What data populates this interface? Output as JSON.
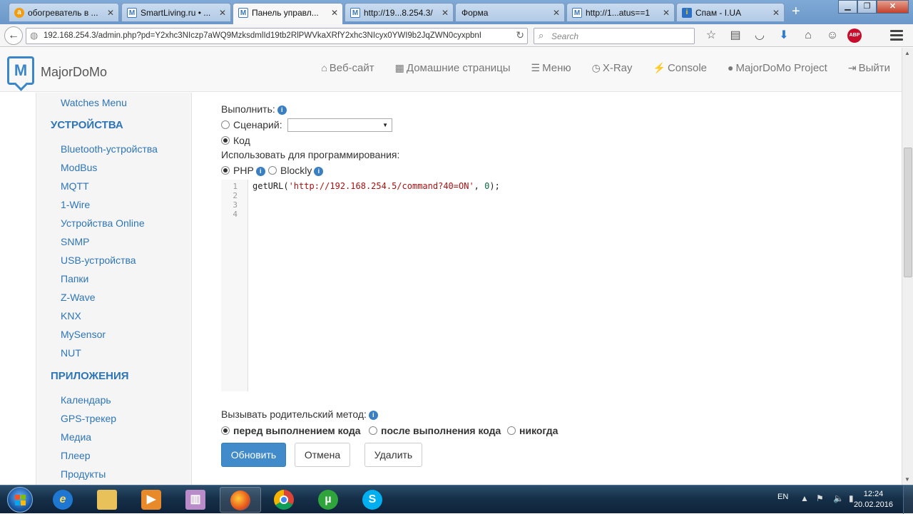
{
  "tabs": [
    {
      "label": "обогреватель в ...",
      "icon": "amazon-favicon"
    },
    {
      "label": "SmartLiving.ru • ...",
      "icon": "majordomo-favicon"
    },
    {
      "label": "Панель управл...",
      "icon": "majordomo-favicon"
    },
    {
      "label": "http://19...8.254.3/",
      "icon": "majordomo-favicon"
    },
    {
      "label": "Форма",
      "icon": ""
    },
    {
      "label": "http://1...atus==1",
      "icon": "majordomo-favicon"
    },
    {
      "label": "Спам - I.UA",
      "icon": "iua-favicon"
    }
  ],
  "url": "192.168.254.3/admin.php?pd=Y2xhc3NIczp7aWQ9MzksdmlId19tb2RlPWVkaXRfY2xhc3NIcyx0YWI9b2JqZWN0cyxpbnI",
  "search_placeholder": "Search",
  "brand": "MajorDoMo",
  "logo_letter": "M",
  "topnav": [
    {
      "label": "Веб-сайт",
      "icon": "⌂"
    },
    {
      "label": "Домашние страницы",
      "icon": "▦"
    },
    {
      "label": "Меню",
      "icon": "☰"
    },
    {
      "label": "X-Ray",
      "icon": "◷"
    },
    {
      "label": "Console",
      "icon": "⚡"
    },
    {
      "label": "MajorDoMo Project",
      "icon": "●"
    },
    {
      "label": "Выйти",
      "icon": "⇥"
    }
  ],
  "sidebar": {
    "partial_item": "Watches Menu",
    "section1": "УСТРОЙСТВА",
    "devices": [
      "Bluetooth-устройства",
      "ModBus",
      "MQTT",
      "1-Wire",
      "Устройства Online",
      "SNMP",
      "USB-устройства",
      "Папки",
      "Z-Wave",
      "KNX",
      "MySensor",
      "NUT"
    ],
    "section2": "ПРИЛОЖЕНИЯ",
    "apps": [
      "Календарь",
      "GPS-трекер",
      "Медиа",
      "Плеер",
      "Продукты"
    ]
  },
  "form": {
    "execute_label": "Выполнить:",
    "scenario_label": "Сценарий:",
    "scenario_value": "",
    "code_label": "Код",
    "programming_label": "Использовать для программирования:",
    "php_label": "PHP",
    "blockly_label": "Blockly",
    "line_numbers": [
      "1",
      "2",
      "3",
      "4"
    ],
    "code_func": "getURL(",
    "code_str": "'http://192.168.254.5/command?40=ON'",
    "code_mid": ", ",
    "code_num": "0",
    "code_end": ");",
    "parent_label": "Вызывать родительский метод:",
    "parent_options": [
      "перед выполнением кода",
      "после выполнения кода",
      "никогда"
    ],
    "parent_selected": 0,
    "selected_mode": "code",
    "selected_lang": "php"
  },
  "buttons": {
    "update": "Обновить",
    "cancel": "Отмена",
    "delete": "Удалить"
  },
  "taskbar": {
    "lang": "EN",
    "time": "12:24",
    "date": "20.02.2016",
    "apps": [
      "internet-explorer",
      "file-explorer",
      "media-player",
      "archive",
      "firefox",
      "chrome",
      "utorrent",
      "skype"
    ]
  },
  "colors": {
    "accent": "#428bca",
    "link": "#2e75b6",
    "sidebar_bg": "#f5f5f5"
  }
}
